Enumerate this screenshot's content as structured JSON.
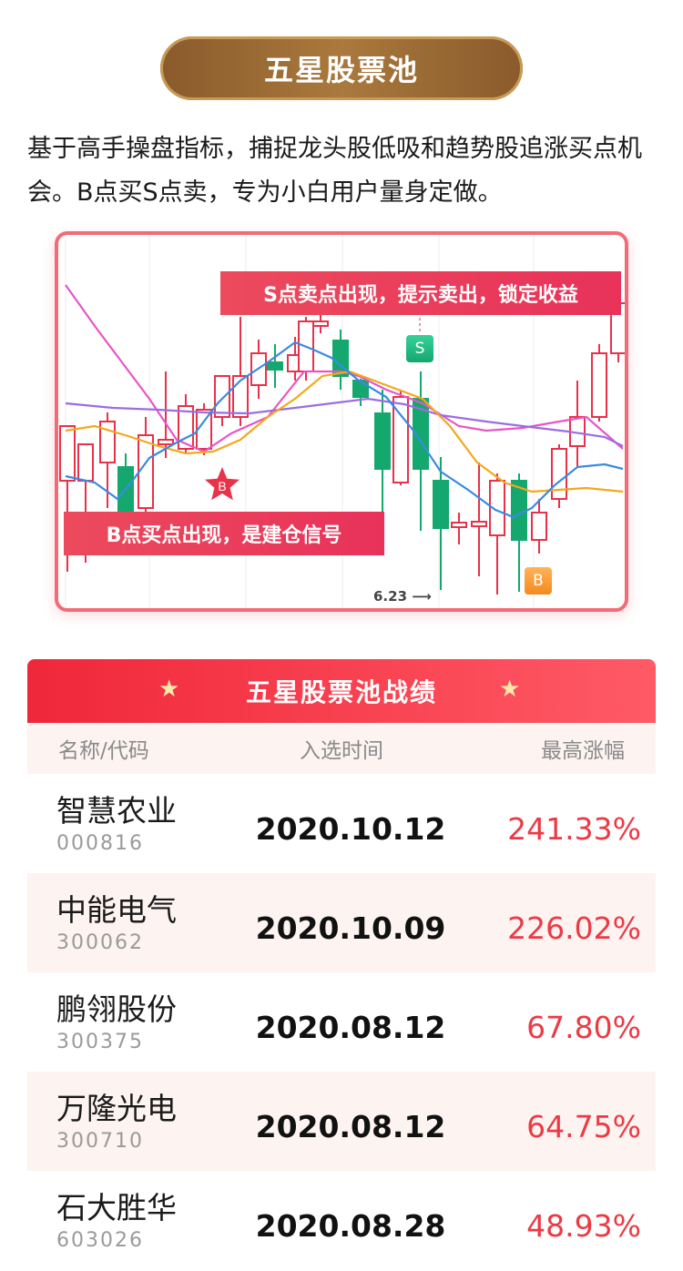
{
  "header": {
    "title": "五星股票池"
  },
  "intro": {
    "text": "基于高手操盘指标，捕捉龙头股低吸和趋势股追涨买点机会。B点买S点卖，专为小白用户量身定做。"
  },
  "chart": {
    "sell_banner": "S点卖点出现，提示卖出，锁定收益",
    "buy_banner": "B点买点出现，是建仓信号",
    "sell_tag": "S",
    "buy_tag": "B",
    "buy_star": "B",
    "date_marker": "6.23 ⟶"
  },
  "table": {
    "title": "五星股票池战绩",
    "star_icon": "★",
    "columns": [
      "名称/代码",
      "入选时间",
      "最高涨幅"
    ],
    "rows": [
      {
        "name": "智慧农业",
        "code": "000816",
        "date": "2020.10.12",
        "gain": "241.33%"
      },
      {
        "name": "中能电气",
        "code": "300062",
        "date": "2020.10.09",
        "gain": "226.02%"
      },
      {
        "name": "鹏翎股份",
        "code": "300375",
        "date": "2020.08.12",
        "gain": "67.80%"
      },
      {
        "name": "万隆光电",
        "code": "300710",
        "date": "2020.08.12",
        "gain": "64.75%"
      },
      {
        "name": "石大胜华",
        "code": "603026",
        "date": "2020.08.28",
        "gain": "48.93%"
      }
    ]
  },
  "colors": {
    "accent_red": "#ec3a45",
    "gold": "#a9793d",
    "candle_up": "#e8324a",
    "candle_down": "#14a86f"
  }
}
